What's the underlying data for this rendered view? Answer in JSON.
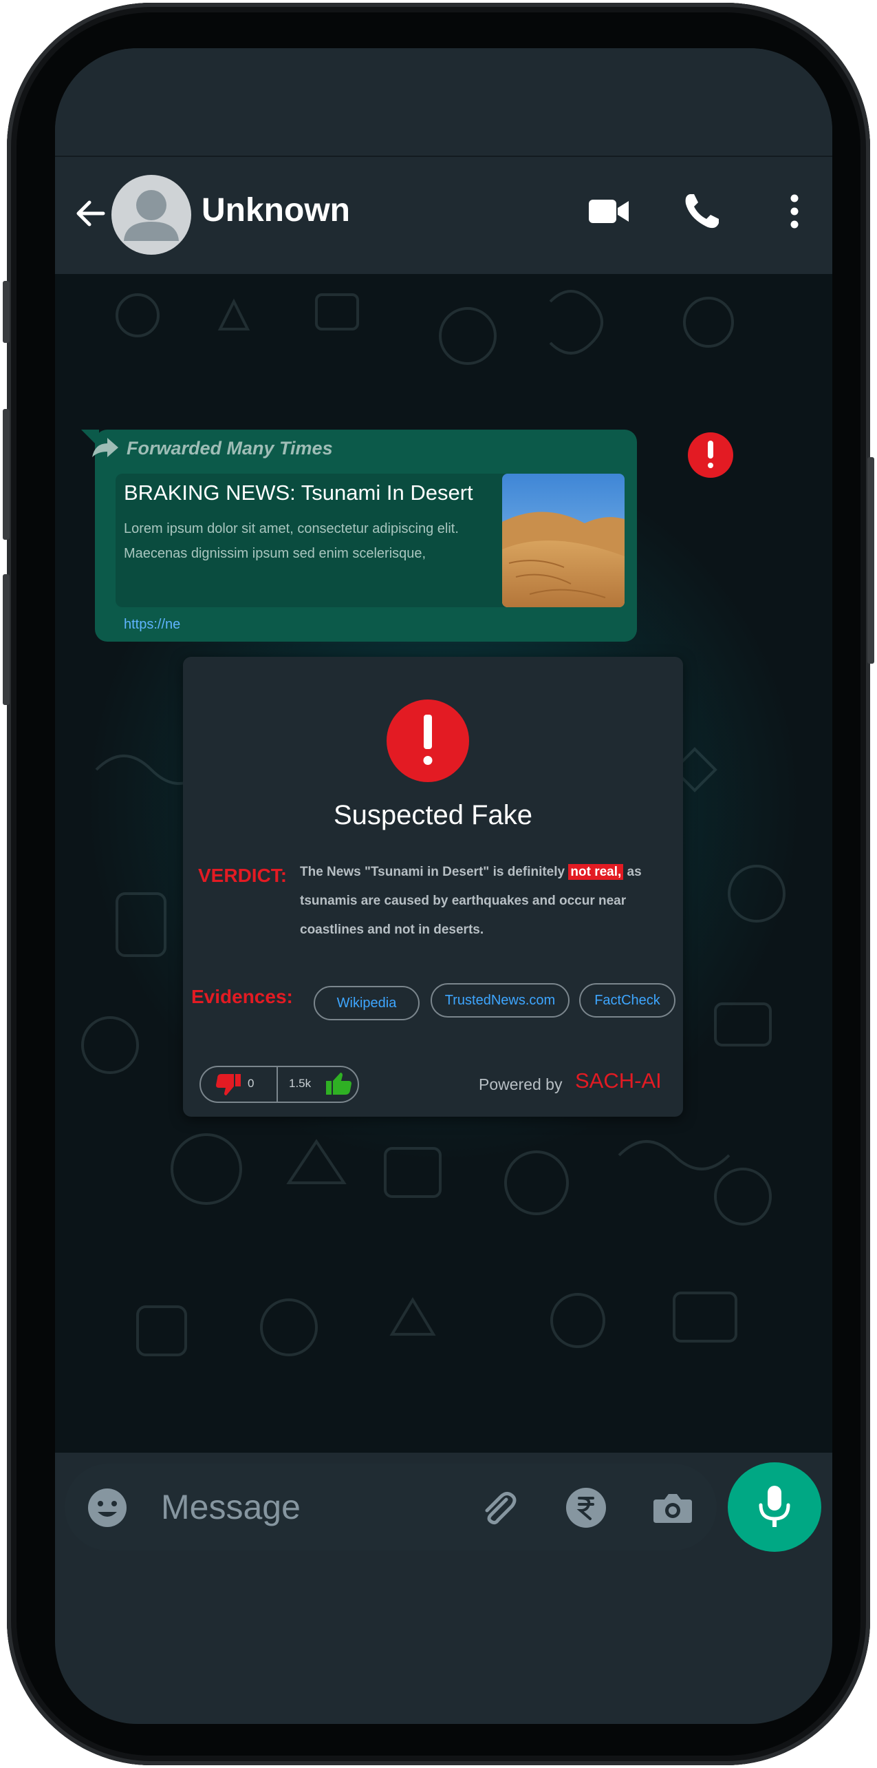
{
  "header": {
    "contact_name": "Unknown"
  },
  "message": {
    "forwarded_label": "Forwarded Many Times",
    "card_title": "BRAKING NEWS: Tsunami In Desert",
    "card_description": "Lorem ipsum dolor sit amet, consectetur adipiscing elit. Maecenas dignissim ipsum sed enim scelerisque,",
    "url_fragment": "https://ne"
  },
  "popup": {
    "title": "Suspected Fake",
    "verdict_label": "VERDICT:",
    "verdict_pre": "The News \"Tsunami in Desert\" is definitely ",
    "verdict_highlight": "not real,",
    "verdict_post": " as tsunamis are caused by earthquakes and occur near coastlines and not in deserts.",
    "evidences_label": "Evidences:",
    "evidences": [
      "Wikipedia",
      "TrustedNews.com",
      "FactCheck"
    ],
    "downvotes": "0",
    "upvotes": "1.5k",
    "powered_by": "Powered by",
    "brand": "SACH-AI"
  },
  "composer": {
    "placeholder": "Message"
  },
  "colors": {
    "alert_red": "#e31b23",
    "accent_green": "#00a884",
    "link_blue": "#3ea6ff",
    "bubble_green": "#0c5a4a"
  },
  "icons": [
    "back-arrow-icon",
    "video-call-icon",
    "phone-icon",
    "more-vert-icon",
    "forward-icon",
    "alert-icon",
    "thumbs-down-icon",
    "thumbs-up-icon",
    "emoji-icon",
    "attach-icon",
    "rupee-icon",
    "camera-icon",
    "mic-icon"
  ]
}
